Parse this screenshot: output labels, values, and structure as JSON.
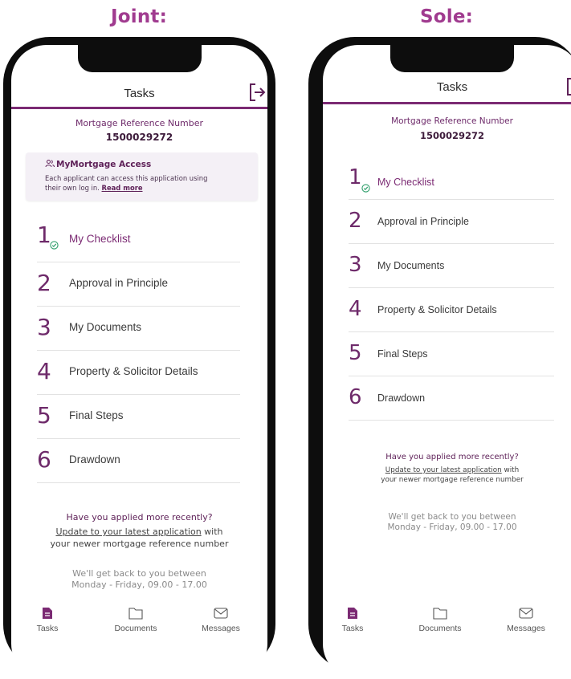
{
  "colors": {
    "brand": "#7B2A73",
    "brand_title": "#A03B8F",
    "check": "#2E9E6A"
  },
  "panels": [
    {
      "heading": "Joint:",
      "app_title": "Tasks",
      "ref_label": "Mortgage Reference Number",
      "ref_number": "1500029272",
      "access_title": "MyMortgage Access",
      "access_text": "Each applicant can access this application using their own log in.",
      "access_link": "Read more",
      "tasks": [
        {
          "num": "1",
          "label": "My Checklist",
          "done": true
        },
        {
          "num": "2",
          "label": "Approval in Principle"
        },
        {
          "num": "3",
          "label": "My Documents"
        },
        {
          "num": "4",
          "label": "Property & Solicitor Details"
        },
        {
          "num": "5",
          "label": "Final Steps"
        },
        {
          "num": "6",
          "label": "Drawdown"
        }
      ],
      "question": "Have you applied more recently?",
      "update_link": "Update to your latest application",
      "update_with": " with",
      "update_rest": "your newer mortgage reference number",
      "hours_line1": "We'll get back to you between",
      "hours_line2": "Monday - Friday, 09.00 - 17.00",
      "tabs": [
        {
          "label": "Tasks",
          "icon": "document-filled-icon"
        },
        {
          "label": "Documents",
          "icon": "folder-icon"
        },
        {
          "label": "Messages",
          "icon": "mail-icon"
        }
      ]
    },
    {
      "heading": "Sole:",
      "app_title": "Tasks",
      "ref_label": "Mortgage Reference Number",
      "ref_number": "1500029272",
      "tasks": [
        {
          "num": "1",
          "label": "My Checklist",
          "done": true
        },
        {
          "num": "2",
          "label": "Approval in Principle"
        },
        {
          "num": "3",
          "label": "My Documents"
        },
        {
          "num": "4",
          "label": "Property & Solicitor Details"
        },
        {
          "num": "5",
          "label": "Final Steps"
        },
        {
          "num": "6",
          "label": "Drawdown"
        }
      ],
      "question": "Have you applied more recently?",
      "update_link": "Update to your latest application",
      "update_with": " with",
      "update_rest": "your newer mortgage reference number",
      "hours_line1": "We'll get back to you between",
      "hours_line2": "Monday - Friday, 09.00 - 17.00",
      "tabs": [
        {
          "label": "Tasks",
          "icon": "document-filled-icon"
        },
        {
          "label": "Documents",
          "icon": "folder-icon"
        },
        {
          "label": "Messages",
          "icon": "mail-icon"
        }
      ]
    }
  ]
}
